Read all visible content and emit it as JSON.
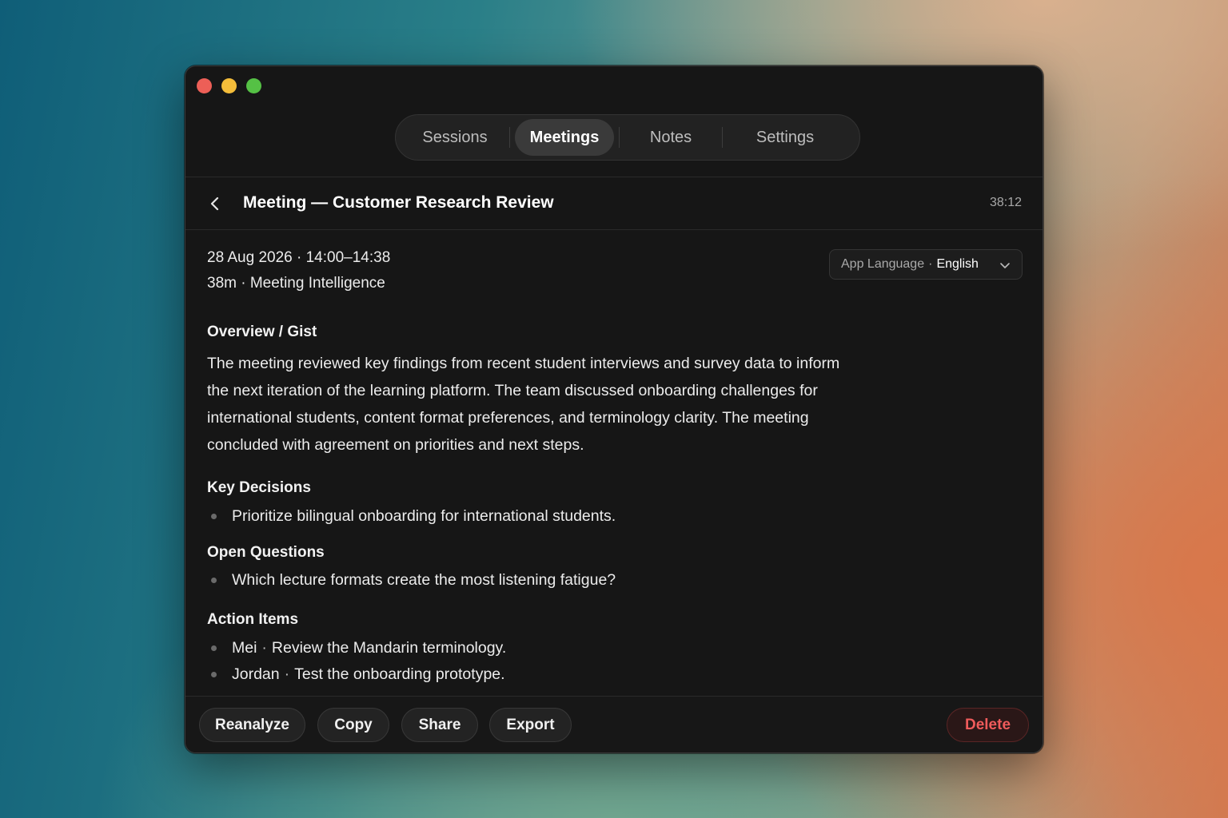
{
  "window": {
    "controls": [
      "close",
      "minimize",
      "maximize"
    ]
  },
  "tabs": [
    {
      "label": "Sessions",
      "active": false
    },
    {
      "label": "Meetings",
      "active": true
    },
    {
      "label": "Notes",
      "active": false
    },
    {
      "label": "Settings",
      "active": false
    }
  ],
  "header": {
    "back_icon": "chevron-left-icon",
    "title": "Meeting — Customer Research Review",
    "duration": "38:12"
  },
  "meta": {
    "date_time": "28 Aug 2026 · 14:00–14:38",
    "subtitle": "38m · Meeting Intelligence"
  },
  "language_select": {
    "label": "App Language",
    "separator": "·",
    "value": "English",
    "icon": "chevron-down-icon"
  },
  "overview": {
    "title": "Overview / Gist",
    "lines": [
      "The meeting reviewed key findings from recent student interviews and survey data to inform",
      "the next iteration of the learning platform. The team discussed onboarding challenges for",
      "international students, content format preferences, and terminology clarity. The meeting",
      "concluded with agreement on priorities and next steps."
    ]
  },
  "key_decisions": {
    "title": "Key Decisions",
    "items": [
      "Prioritize bilingual onboarding for international students."
    ]
  },
  "open_questions": {
    "title": "Open Questions",
    "items": [
      "Which lecture formats create the most listening fatigue?"
    ]
  },
  "action_items": {
    "title": "Action Items",
    "separator": "·",
    "items": [
      {
        "owner": "Mei",
        "task": "Review the Mandarin terminology."
      },
      {
        "owner": "Jordan",
        "task": "Test the onboarding prototype."
      }
    ]
  },
  "footer": {
    "reanalyze": "Reanalyze",
    "copy": "Copy",
    "share": "Share",
    "export": "Export",
    "delete": "Delete"
  },
  "colors": {
    "window_bg": "#161616",
    "delete_text": "#ef5b5b",
    "close": "#ed5f57",
    "minimize": "#f4bd3a",
    "maximize": "#55c145"
  }
}
